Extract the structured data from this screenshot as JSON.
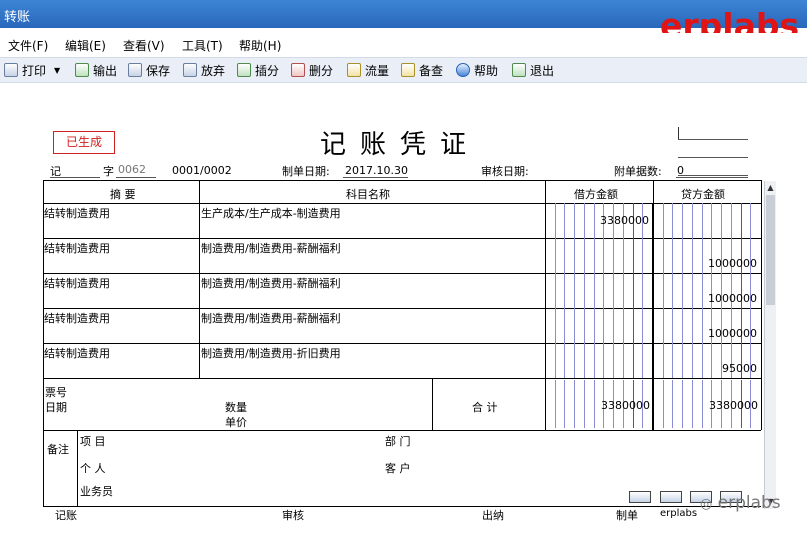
{
  "window": {
    "title": "转账",
    "brand": "erplabs"
  },
  "menu": [
    "文件(F)",
    "编辑(E)",
    "查看(V)",
    "工具(T)",
    "帮助(H)"
  ],
  "toolbar": [
    "打印",
    "输出",
    "保存",
    "放弃",
    "插分",
    "删分",
    "流量",
    "备查",
    "帮助",
    "退出"
  ],
  "voucher": {
    "status": "已生成",
    "title": "记账凭证",
    "type_label": "记",
    "number_label": "字",
    "number_value": "0062",
    "page": "0001/0002",
    "date_label": "制单日期:",
    "date_value": "2017.10.30",
    "audit_date_label": "审核日期:",
    "attachments_label": "附单据数:",
    "attachments_value": "0"
  },
  "table": {
    "headers": {
      "summary": "摘 要",
      "account": "科目名称",
      "debit": "借方金额",
      "credit": "贷方金额"
    },
    "rows": [
      {
        "summary": "结转制造费用",
        "account": "生产成本/生产成本-制造费用",
        "debit": "3380000",
        "credit": ""
      },
      {
        "summary": "结转制造费用",
        "account": "制造费用/制造费用-薪酬福利",
        "debit": "",
        "credit": "1000000"
      },
      {
        "summary": "结转制造费用",
        "account": "制造费用/制造费用-薪酬福利",
        "debit": "",
        "credit": "1000000"
      },
      {
        "summary": "结转制造费用",
        "account": "制造费用/制造费用-薪酬福利",
        "debit": "",
        "credit": "1000000"
      },
      {
        "summary": "结转制造费用",
        "account": "制造费用/制造费用-折旧费用",
        "debit": "",
        "credit": "95000"
      }
    ],
    "footer": {
      "ticket_label": "票号",
      "date_label": "日期",
      "quantity_label": "数量",
      "unit_price_label": "单价",
      "total_label": "合 计",
      "debit_total": "3380000",
      "credit_total": "3380000"
    },
    "notes": {
      "label": "备注",
      "project_label": "项 目",
      "department_label": "部 门",
      "person_label": "个 人",
      "customer_label": "客 户",
      "salesperson_label": "业务员"
    }
  },
  "signatures": {
    "bookkeeper_label": "记账",
    "reviewer_label": "审核",
    "cashier_label": "出纳",
    "preparer_label": "制单",
    "preparer_value": "erplabs"
  },
  "watermark": "erplabs"
}
